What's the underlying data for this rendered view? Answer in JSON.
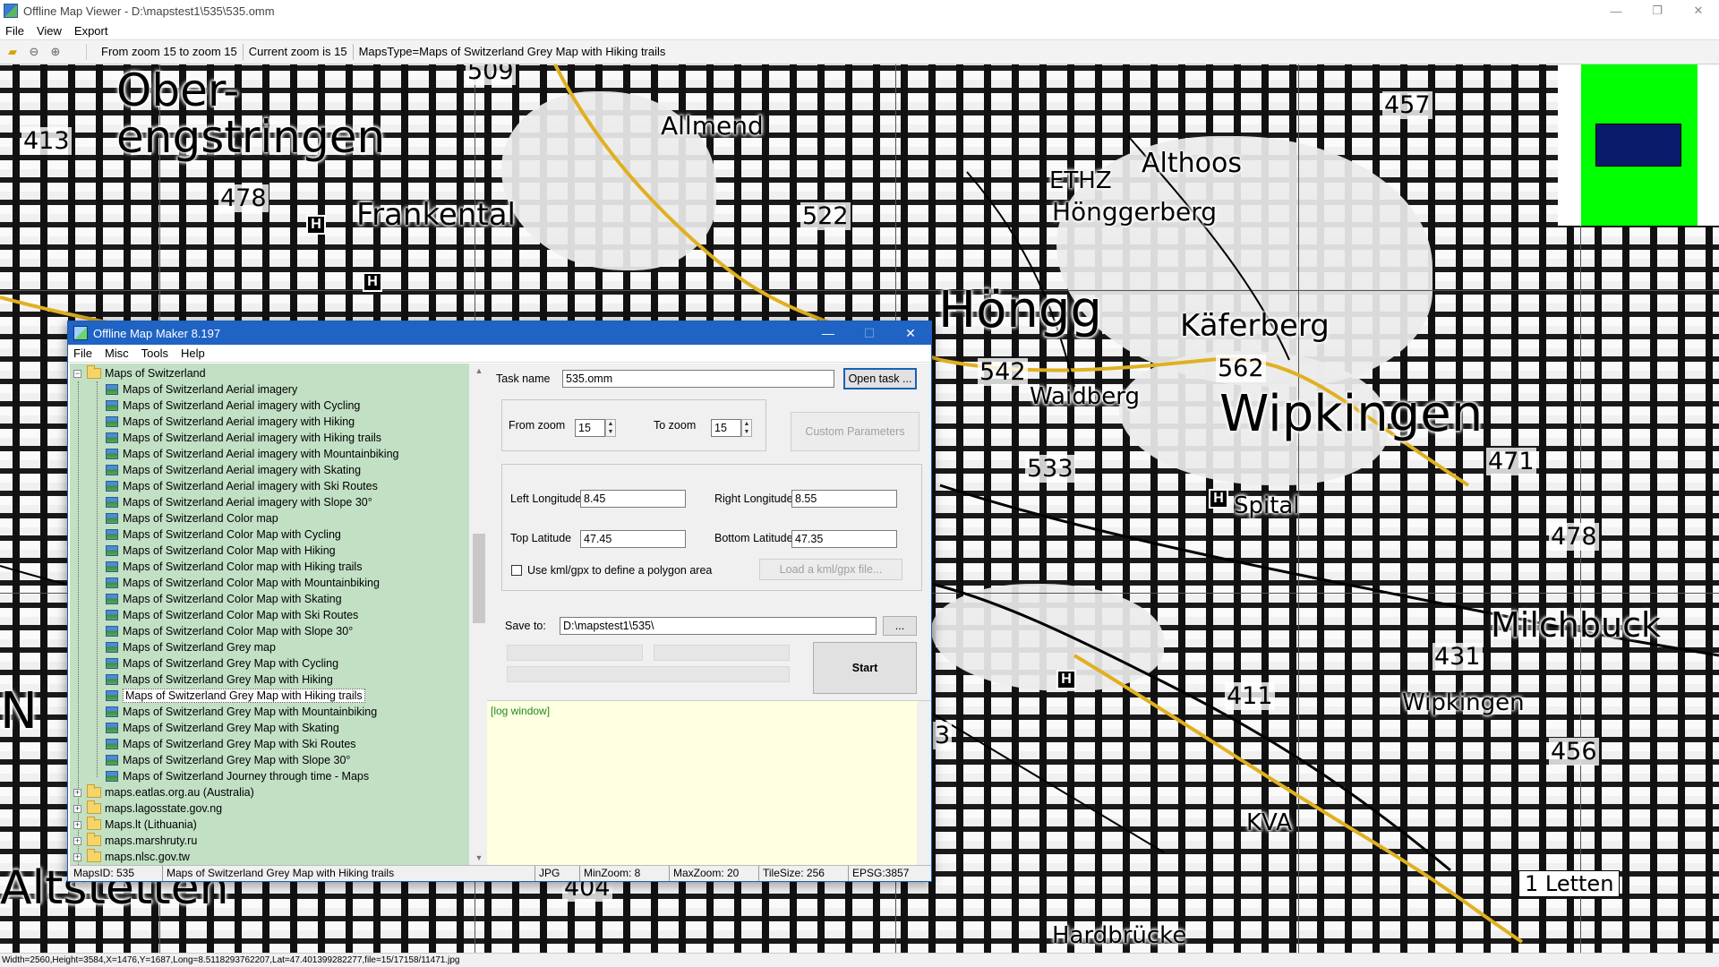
{
  "window": {
    "title": "Offline Map Viewer - D:\\mapstest1\\535\\535.omm",
    "controls": {
      "minimize": "—",
      "maximize": "❐",
      "close": "✕"
    }
  },
  "menu": [
    "File",
    "View",
    "Export"
  ],
  "toolbar": {
    "info": [
      "From zoom 15 to zoom 15",
      "Current zoom is 15",
      "MapsType=Maps of Switzerland Grey Map with Hiking trails"
    ]
  },
  "map": {
    "places": [
      {
        "text": "Ober-",
        "size": 50
      },
      {
        "text": "engstringen",
        "size": 50
      },
      {
        "text": "Frankental",
        "size": 34
      },
      {
        "text": "Allmend",
        "size": 28
      },
      {
        "text": "ETHZ",
        "size": 26
      },
      {
        "text": "Althoos",
        "size": 30
      },
      {
        "text": "Hönggerberg",
        "size": 28
      },
      {
        "text": "Höngg",
        "size": 56
      },
      {
        "text": "Käferberg",
        "size": 34
      },
      {
        "text": "Waidberg",
        "size": 26
      },
      {
        "text": "Wipkingen",
        "size": 56
      },
      {
        "text": "Spital",
        "size": 26
      },
      {
        "text": "Milchbuck",
        "size": 38
      },
      {
        "text": "Wipkingen",
        "size": 26
      },
      {
        "text": "KVA",
        "size": 26
      },
      {
        "text": "Hardbrücke",
        "size": 26
      },
      {
        "text": "Altstetten",
        "size": 52
      },
      {
        "text": "1 Letten",
        "size": 24
      },
      {
        "text": "N",
        "size": 56
      }
    ],
    "elevations": [
      "413",
      "478",
      "509",
      "522",
      "457",
      "542",
      "562",
      "533",
      "471",
      "478",
      "431",
      "411",
      "456",
      "404",
      "3"
    ],
    "helipads": [
      "H",
      "H",
      "H",
      "H"
    ]
  },
  "statusbar": "Width=2560,Height=3584,X=1476,Y=1687,Long=8.5118293762207,Lat=47.401399282277,file=15/17158/11471.jpg",
  "dialog": {
    "title": "Offline Map Maker 8.197",
    "menu": [
      "File",
      "Misc",
      "Tools",
      "Help"
    ],
    "tree": {
      "root": "Maps of Switzerland",
      "children": [
        "Maps of Switzerland Aerial imagery",
        "Maps of Switzerland Aerial imagery with Cycling",
        "Maps of Switzerland Aerial imagery with Hiking",
        "Maps of Switzerland Aerial imagery with Hiking trails",
        "Maps of Switzerland Aerial imagery with Mountainbiking",
        "Maps of Switzerland Aerial imagery with Skating",
        "Maps of Switzerland Aerial imagery with Ski Routes",
        "Maps of Switzerland Aerial imagery with Slope 30°",
        "Maps of Switzerland Color map",
        "Maps of Switzerland Color Map with Cycling",
        "Maps of Switzerland Color Map with Hiking",
        "Maps of Switzerland Color map with Hiking trails",
        "Maps of Switzerland Color Map with Mountainbiking",
        "Maps of Switzerland Color Map with Skating",
        "Maps of Switzerland Color Map with Ski Routes",
        "Maps of Switzerland Color Map with Slope 30°",
        "Maps of Switzerland Grey map",
        "Maps of Switzerland Grey Map with Cycling",
        "Maps of Switzerland Grey Map with Hiking",
        "Maps of Switzerland Grey Map with Hiking trails",
        "Maps of Switzerland Grey Map with Mountainbiking",
        "Maps of Switzerland Grey Map with Skating",
        "Maps of Switzerland Grey Map with Ski Routes",
        "Maps of Switzerland Grey Map with Slope 30°",
        "Maps of Switzerland Journey through time - Maps"
      ],
      "selected_index": 19,
      "siblings": [
        "maps.eatlas.org.au (Australia)",
        "maps.lagosstate.gov.ng",
        "Maps.lt (Lithuania)",
        "maps.marshruty.ru",
        "maps.nlsc.gov.tw"
      ]
    },
    "form": {
      "task_name_label": "Task name",
      "task_name_value": "535.omm",
      "open_task": "Open task ...",
      "from_zoom_label": "From zoom",
      "from_zoom_value": "15",
      "to_zoom_label": "To zoom",
      "to_zoom_value": "15",
      "custom_parameters": "Custom Parameters",
      "left_longitude_label": "Left Longitude",
      "left_longitude_value": "8.45",
      "right_longitude_label": "Right Longitude",
      "right_longitude_value": "8.55",
      "top_latitude_label": "Top Latitude",
      "top_latitude_value": "47.45",
      "bottom_latitude_label": "Bottom Latitude",
      "bottom_latitude_value": "47.35",
      "use_kml_label": "Use kml/gpx to define a polygon area",
      "load_kml": "Load a kml/gpx file...",
      "save_to_label": "Save to:",
      "save_to_value": "D:\\mapstest1\\535\\",
      "browse": "...",
      "start": "Start"
    },
    "log": "[log window]",
    "status": [
      "MapsID: 535",
      "Maps of Switzerland Grey Map with Hiking trails",
      "JPG",
      "MinZoom: 8",
      "MaxZoom: 20",
      "TileSize: 256",
      "EPSG:3857"
    ]
  },
  "colors": {
    "dialog_title": "#1f63c4",
    "tree_bg": "#c2e0c4",
    "log_bg": "#ffffe1",
    "minimap": "#00ff00",
    "minimap_view": "#0a1a6a",
    "trail": "#e0b020"
  }
}
